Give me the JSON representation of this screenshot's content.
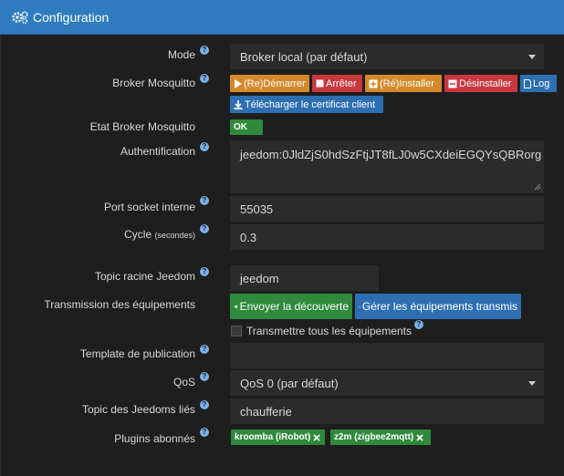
{
  "header": {
    "title": "Configuration",
    "icon": "cogs-icon"
  },
  "colors": {
    "header": "#2e7bbd",
    "background": "#1e1e1e",
    "field": "#2b2b2b",
    "orange": "#d48a2a",
    "red": "#c9383d",
    "blue": "#2e6fb1",
    "green": "#2f8a3c"
  },
  "mode": {
    "label": "Mode",
    "value": "Broker local (par défaut)"
  },
  "broker": {
    "label": "Broker Mosquitto",
    "restart": "(Re)Démarrer",
    "stop": "Arrêter",
    "install": "(Ré)Installer",
    "uninstall": "Désinstaller",
    "log": "Log",
    "download_cert": "Télécharger le certificat client"
  },
  "status": {
    "label": "Etat Broker Mosquitto",
    "value": "OK"
  },
  "auth": {
    "label": "Authentification",
    "value": "jeedom:0JldZjS0hdSzFtjJT8fLJ0w5CXdeiEGQYsQBRorg"
  },
  "port": {
    "label": "Port socket interne",
    "value": "55035"
  },
  "cycle": {
    "label": "Cycle",
    "unit": "(secondes)",
    "value": "0.3"
  },
  "topic_root": {
    "label": "Topic racine Jeedom",
    "value": "jeedom"
  },
  "transmission": {
    "label": "Transmission des équipements",
    "send_discovery": "Envoyer la découverte",
    "manage": "Gérer les équipements transmis",
    "transmit_all": "Transmettre tous les équipements"
  },
  "template": {
    "label": "Template de publication",
    "value": ""
  },
  "qos": {
    "label": "QoS",
    "value": "QoS 0 (par défaut)"
  },
  "linked_topics": {
    "label": "Topic des Jeedoms liés",
    "value": "chaufferie"
  },
  "plugins": {
    "label": "Plugins abonnés",
    "items": [
      "kroomba (iRobot)",
      "z2m (zigbee2mqtt)"
    ]
  },
  "help_glyph": "?"
}
